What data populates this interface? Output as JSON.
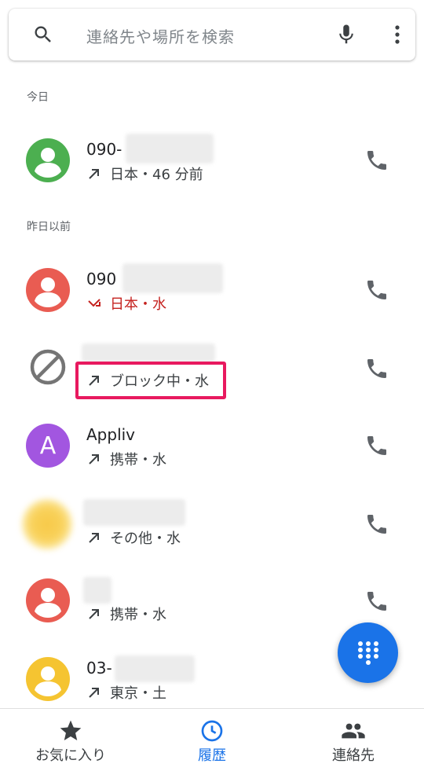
{
  "search": {
    "placeholder": "連絡先や場所を検索"
  },
  "sections": {
    "today": "今日",
    "earlier": "昨日以前"
  },
  "calls": [
    {
      "name": "090-",
      "meta": "日本・46 分前",
      "type": "outgoing",
      "avatar": "person",
      "color": "#4caf50"
    },
    {
      "name": "090",
      "meta": "日本・水",
      "type": "missed",
      "avatar": "person",
      "color": "#e95c52"
    },
    {
      "name": "",
      "meta": "ブロック中・水",
      "type": "outgoing",
      "avatar": "blocked",
      "color": "#757575"
    },
    {
      "name": "Appliv",
      "meta": "携帯・水",
      "type": "outgoing",
      "avatar": "letter",
      "letter": "A",
      "color": "#a256e0"
    },
    {
      "name": "",
      "meta": "その他・水",
      "type": "outgoing",
      "avatar": "photo",
      "color": "#f7c948"
    },
    {
      "name": "",
      "meta": "携帯・水",
      "type": "outgoing",
      "avatar": "person",
      "color": "#e95c52"
    },
    {
      "name": "03-",
      "meta": "東京・土",
      "type": "outgoing",
      "avatar": "person",
      "color": "#f5c431"
    }
  ],
  "nav": {
    "favorites": "お気に入り",
    "history": "履歴",
    "contacts": "連絡先",
    "active": "history"
  },
  "colors": {
    "accent": "#1a73e8",
    "highlight": "#e8195f",
    "missed": "#c5221f"
  }
}
